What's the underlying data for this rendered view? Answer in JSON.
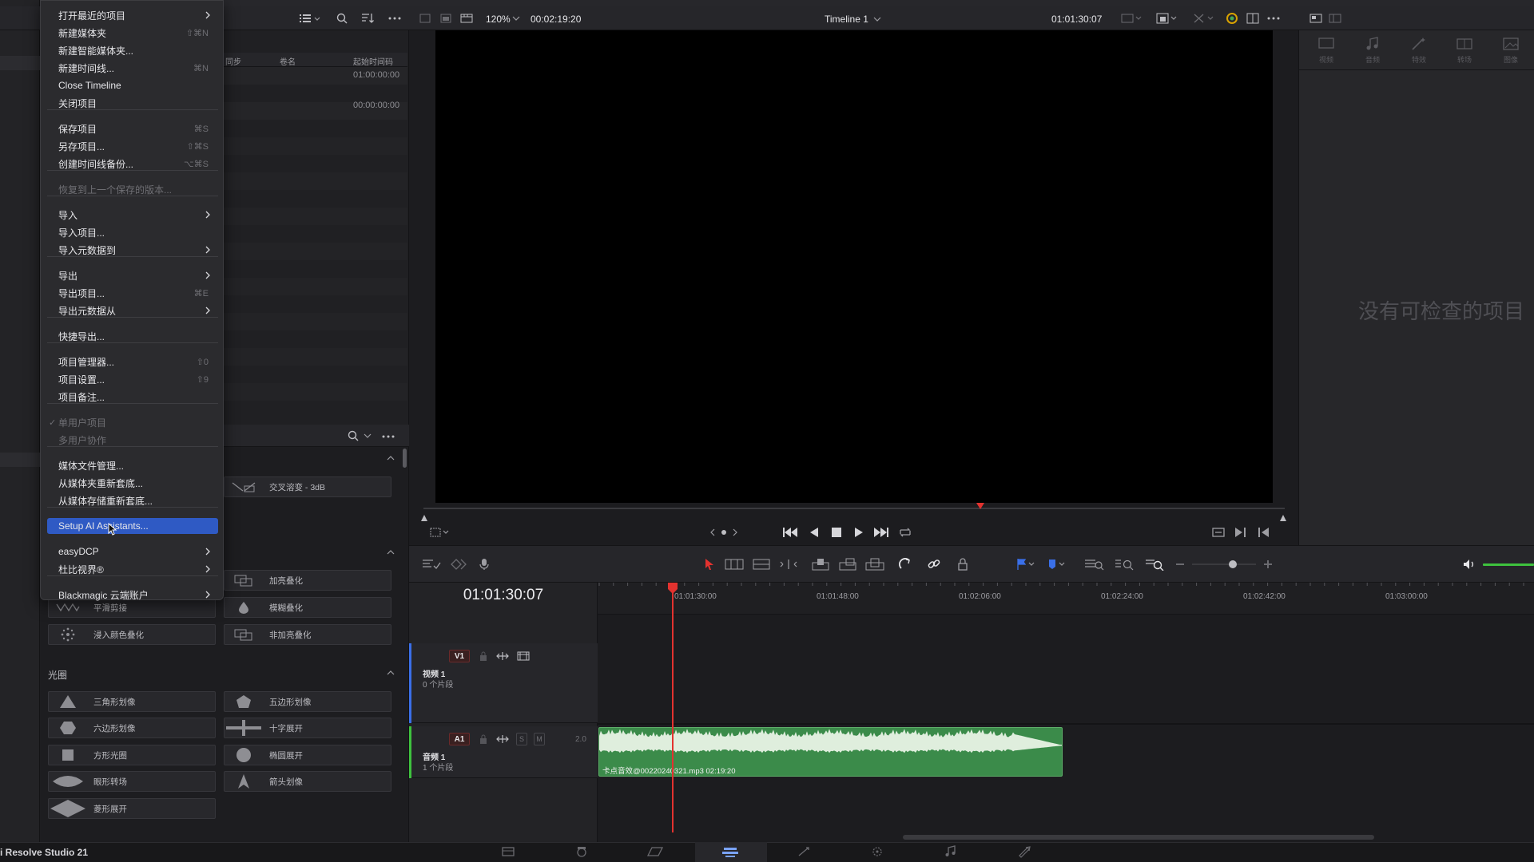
{
  "app": {
    "name": "i Resolve Studio 21"
  },
  "file_menu": {
    "items": [
      {
        "label": "打开最近的项目",
        "shortcut": "",
        "submenu": true,
        "disabled": false
      },
      {
        "label": "新建媒体夹",
        "shortcut": "⇧⌘N",
        "submenu": false,
        "disabled": false
      },
      {
        "label": "新建智能媒体夹...",
        "shortcut": "",
        "submenu": false,
        "disabled": false
      },
      {
        "label": "新建时间线...",
        "shortcut": "⌘N",
        "submenu": false,
        "disabled": false
      },
      {
        "label": "Close Timeline",
        "shortcut": "",
        "submenu": false,
        "disabled": false
      },
      {
        "label": "关闭项目",
        "shortcut": "",
        "submenu": false,
        "disabled": false
      },
      {
        "label": "保存项目",
        "shortcut": "⌘S",
        "submenu": false,
        "disabled": false
      },
      {
        "label": "另存项目...",
        "shortcut": "⇧⌘S",
        "submenu": false,
        "disabled": false
      },
      {
        "label": "创建时间线备份...",
        "shortcut": "⌥⌘S",
        "submenu": false,
        "disabled": false
      },
      {
        "label": "恢复到上一个保存的版本...",
        "shortcut": "",
        "submenu": false,
        "disabled": true
      },
      {
        "label": "导入",
        "shortcut": "",
        "submenu": true,
        "disabled": false
      },
      {
        "label": "导入项目...",
        "shortcut": "",
        "submenu": false,
        "disabled": false
      },
      {
        "label": "导入元数据到",
        "shortcut": "",
        "submenu": true,
        "disabled": false
      },
      {
        "label": "导出",
        "shortcut": "",
        "submenu": true,
        "disabled": false
      },
      {
        "label": "导出项目...",
        "shortcut": "⌘E",
        "submenu": false,
        "disabled": false
      },
      {
        "label": "导出元数据从",
        "shortcut": "",
        "submenu": true,
        "disabled": false
      },
      {
        "label": "快捷导出...",
        "shortcut": "",
        "submenu": false,
        "disabled": false
      },
      {
        "label": "项目管理器...",
        "shortcut": "⇧0",
        "submenu": false,
        "disabled": false
      },
      {
        "label": "项目设置...",
        "shortcut": "⇧9",
        "submenu": false,
        "disabled": false
      },
      {
        "label": "项目备注...",
        "shortcut": "",
        "submenu": false,
        "disabled": false
      },
      {
        "label": "单用户项目",
        "shortcut": "",
        "submenu": false,
        "disabled": true,
        "checked": true
      },
      {
        "label": "多用户协作",
        "shortcut": "",
        "submenu": false,
        "disabled": true
      },
      {
        "label": "媒体文件管理...",
        "shortcut": "",
        "submenu": false,
        "disabled": false
      },
      {
        "label": "从媒体夹重新套底...",
        "shortcut": "",
        "submenu": false,
        "disabled": false
      },
      {
        "label": "从媒体存储重新套底...",
        "shortcut": "",
        "submenu": false,
        "disabled": false
      },
      {
        "label": "Setup AI Assistants...",
        "shortcut": "",
        "submenu": false,
        "disabled": false,
        "active": true
      },
      {
        "label": "easyDCP",
        "shortcut": "",
        "submenu": true,
        "disabled": false
      },
      {
        "label": "杜比视界®",
        "shortcut": "",
        "submenu": true,
        "disabled": false
      },
      {
        "label": "Blackmagic 云端账户",
        "shortcut": "",
        "submenu": true,
        "disabled": false
      }
    ]
  },
  "media_pool": {
    "columns": [
      "同步",
      "卷名",
      "起始时间码"
    ],
    "values": [
      "01:00:00:00",
      "00:00:00:00"
    ]
  },
  "effects": {
    "partial_row": [
      "交叉溶变 - 3dB"
    ],
    "row2": [
      "加亮叠化"
    ],
    "row3": [
      "平滑剪接",
      "模糊叠化"
    ],
    "row4": [
      "浸入颜色叠化",
      "非加亮叠化"
    ],
    "iris_title": "光圈",
    "iris": [
      "三角形划像",
      "五边形划像",
      "六边形划像",
      "十字展开",
      "方形光圈",
      "椭圆展开",
      "眼形转场",
      "箭头划像",
      "菱形展开"
    ]
  },
  "viewer": {
    "zoom": "120%",
    "source_tc": "00:02:19:20",
    "timeline_name": "Timeline 1",
    "record_tc": "01:01:30:07"
  },
  "inspector": {
    "tabs": [
      "视频",
      "音频",
      "特效",
      "转场",
      "图像"
    ],
    "empty_message": "没有可检查的项目"
  },
  "timeline": {
    "timecode": "01:01:30:07",
    "ruler": [
      "01:01:30:00",
      "01:01:48:00",
      "01:02:06:00",
      "01:02:24:00",
      "01:02:42:00",
      "01:03:00:00"
    ],
    "tracks": {
      "video": {
        "id": "V1",
        "name": "视频 1",
        "clips": "0 个片段"
      },
      "audio": {
        "id": "A1",
        "name": "音频 1",
        "clips": "1 个片段",
        "channels": "2.0",
        "solo": "S",
        "mute": "M"
      }
    },
    "audio_clip_label": "卡点音效@00220240321.mp3  02:19:20"
  },
  "colors": {
    "accent": "#2f5ac4",
    "playhead": "#e3322f",
    "audio_clip": "#3b8b4a"
  }
}
